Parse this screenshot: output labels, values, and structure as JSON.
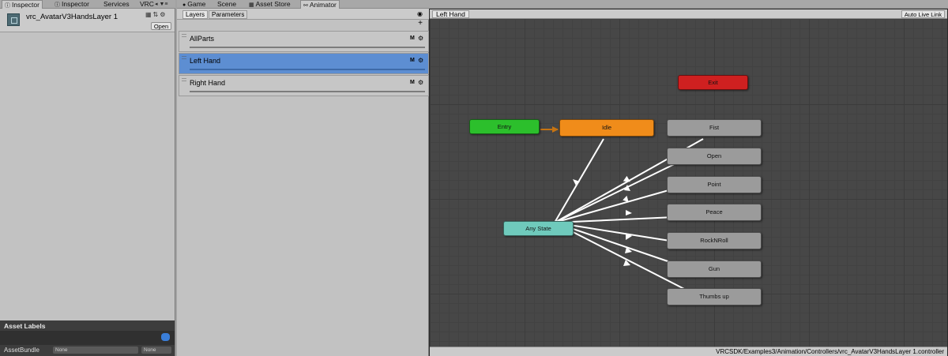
{
  "tabs_left": {
    "inspector_active": "Inspector",
    "inspector_2": "Inspector",
    "services": "Services",
    "vrc": "VRC"
  },
  "tabs_right": {
    "game": "Game",
    "scene": "Scene",
    "asset_store": "Asset Store",
    "animator": "Animator"
  },
  "inspector": {
    "title": "vrc_AvatarV3HandsLayer 1",
    "open_label": "Open"
  },
  "asset_labels": {
    "title": "Asset Labels",
    "bundle_label": "AssetBundle",
    "bundle_value": "None",
    "variant_value": "None"
  },
  "layers_panel": {
    "tab_layers": "Layers",
    "tab_parameters": "Parameters",
    "add_label": "+",
    "m_label": "M",
    "layers": [
      {
        "name": "AllParts"
      },
      {
        "name": "Left Hand"
      },
      {
        "name": "Right Hand"
      }
    ]
  },
  "animator": {
    "breadcrumb": "Left Hand",
    "auto_live_link": "Auto Live Link",
    "status_path": "VRCSDK/Examples3/Animation/Controllers/vrc_AvatarV3HandsLayer 1.controller",
    "colors": {
      "entry": "#2cbf2c",
      "exit": "#cf2020",
      "default": "#f08c1a",
      "any": "#6fcabc",
      "state": "#9b9b9b"
    },
    "nodes": {
      "exit": "Exit",
      "entry": "Entry",
      "idle": "Idle",
      "any": "Any State",
      "fist": "Fist",
      "open": "Open",
      "point": "Point",
      "peace": "Peace",
      "rocknroll": "RockNRoll",
      "gun": "Gun",
      "thumbsup": "Thumbs up"
    }
  }
}
